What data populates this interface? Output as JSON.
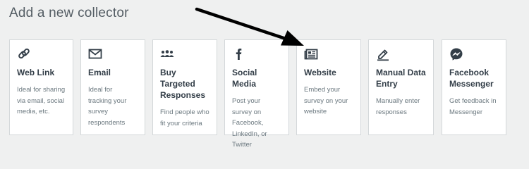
{
  "page": {
    "title": "Add a new collector"
  },
  "collectors": [
    {
      "icon": "link-icon",
      "name": "Web Link",
      "description": "Ideal for sharing via email, social media, etc."
    },
    {
      "icon": "envelope-icon",
      "name": "Email",
      "description": "Ideal for tracking your survey respondents"
    },
    {
      "icon": "people-icon",
      "name": "Buy Targeted Responses",
      "description": "Find people who fit your criteria"
    },
    {
      "icon": "facebook-icon",
      "name": "Social Media",
      "description": "Post your survey on Facebook, LinkedIn, or Twitter"
    },
    {
      "icon": "website-icon",
      "name": "Website",
      "description": "Embed your survey on your website"
    },
    {
      "icon": "pencil-icon",
      "name": "Manual Data Entry",
      "description": "Manually enter responses"
    },
    {
      "icon": "messenger-icon",
      "name": "Facebook Messenger",
      "description": "Get feedback in Messenger"
    }
  ],
  "colors": {
    "background": "#eff0f0",
    "card": "#ffffff",
    "card_border": "#d4d8da",
    "title_text": "#333e48",
    "body_text": "#6b787f",
    "annotation_arrow": "#000000"
  }
}
